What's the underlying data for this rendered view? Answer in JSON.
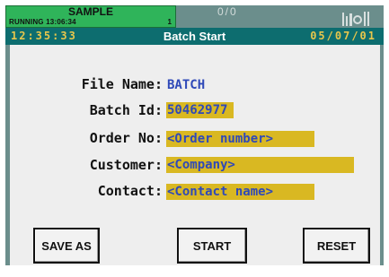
{
  "status": {
    "title": "SAMPLE",
    "line": "RUNNING 13:06:34",
    "index": "1"
  },
  "ratio": "0/0",
  "signal_icon": "signal-strength-icon",
  "titlebar": {
    "time": "12:35:33",
    "title": "Batch Start",
    "date": "05/07/01"
  },
  "form": {
    "file_name": {
      "label": "File Name:",
      "value": "BATCH"
    },
    "batch_id": {
      "label": "Batch Id:",
      "value": "50462977"
    },
    "order_no": {
      "label": "Order No:",
      "value": "<Order number>"
    },
    "customer": {
      "label": "Customer:",
      "value": "<Company>"
    },
    "contact": {
      "label": "Contact:",
      "value": "<Contact name>"
    }
  },
  "buttons": {
    "save_as": "SAVE AS",
    "start": "START",
    "reset": "RESET"
  },
  "colors": {
    "status_green": "#2fb45a",
    "titlebar": "#0d6d6f",
    "accent_yellow": "#e7c64c",
    "highlight": "#d9b822",
    "value_blue": "#2f49b8"
  }
}
